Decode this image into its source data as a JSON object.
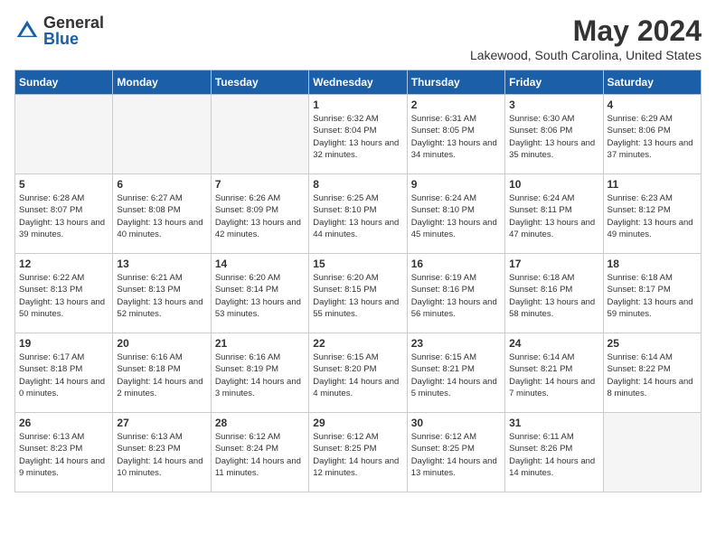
{
  "header": {
    "logo_general": "General",
    "logo_blue": "Blue",
    "month_year": "May 2024",
    "location": "Lakewood, South Carolina, United States"
  },
  "weekdays": [
    "Sunday",
    "Monday",
    "Tuesday",
    "Wednesday",
    "Thursday",
    "Friday",
    "Saturday"
  ],
  "weeks": [
    [
      {
        "day": "",
        "empty": true
      },
      {
        "day": "",
        "empty": true
      },
      {
        "day": "",
        "empty": true
      },
      {
        "day": "1",
        "sunrise": "6:32 AM",
        "sunset": "8:04 PM",
        "daylight": "13 hours and 32 minutes."
      },
      {
        "day": "2",
        "sunrise": "6:31 AM",
        "sunset": "8:05 PM",
        "daylight": "13 hours and 34 minutes."
      },
      {
        "day": "3",
        "sunrise": "6:30 AM",
        "sunset": "8:06 PM",
        "daylight": "13 hours and 35 minutes."
      },
      {
        "day": "4",
        "sunrise": "6:29 AM",
        "sunset": "8:06 PM",
        "daylight": "13 hours and 37 minutes."
      }
    ],
    [
      {
        "day": "5",
        "sunrise": "6:28 AM",
        "sunset": "8:07 PM",
        "daylight": "13 hours and 39 minutes."
      },
      {
        "day": "6",
        "sunrise": "6:27 AM",
        "sunset": "8:08 PM",
        "daylight": "13 hours and 40 minutes."
      },
      {
        "day": "7",
        "sunrise": "6:26 AM",
        "sunset": "8:09 PM",
        "daylight": "13 hours and 42 minutes."
      },
      {
        "day": "8",
        "sunrise": "6:25 AM",
        "sunset": "8:10 PM",
        "daylight": "13 hours and 44 minutes."
      },
      {
        "day": "9",
        "sunrise": "6:24 AM",
        "sunset": "8:10 PM",
        "daylight": "13 hours and 45 minutes."
      },
      {
        "day": "10",
        "sunrise": "6:24 AM",
        "sunset": "8:11 PM",
        "daylight": "13 hours and 47 minutes."
      },
      {
        "day": "11",
        "sunrise": "6:23 AM",
        "sunset": "8:12 PM",
        "daylight": "13 hours and 49 minutes."
      }
    ],
    [
      {
        "day": "12",
        "sunrise": "6:22 AM",
        "sunset": "8:13 PM",
        "daylight": "13 hours and 50 minutes."
      },
      {
        "day": "13",
        "sunrise": "6:21 AM",
        "sunset": "8:13 PM",
        "daylight": "13 hours and 52 minutes."
      },
      {
        "day": "14",
        "sunrise": "6:20 AM",
        "sunset": "8:14 PM",
        "daylight": "13 hours and 53 minutes."
      },
      {
        "day": "15",
        "sunrise": "6:20 AM",
        "sunset": "8:15 PM",
        "daylight": "13 hours and 55 minutes."
      },
      {
        "day": "16",
        "sunrise": "6:19 AM",
        "sunset": "8:16 PM",
        "daylight": "13 hours and 56 minutes."
      },
      {
        "day": "17",
        "sunrise": "6:18 AM",
        "sunset": "8:16 PM",
        "daylight": "13 hours and 58 minutes."
      },
      {
        "day": "18",
        "sunrise": "6:18 AM",
        "sunset": "8:17 PM",
        "daylight": "13 hours and 59 minutes."
      }
    ],
    [
      {
        "day": "19",
        "sunrise": "6:17 AM",
        "sunset": "8:18 PM",
        "daylight": "14 hours and 0 minutes."
      },
      {
        "day": "20",
        "sunrise": "6:16 AM",
        "sunset": "8:18 PM",
        "daylight": "14 hours and 2 minutes."
      },
      {
        "day": "21",
        "sunrise": "6:16 AM",
        "sunset": "8:19 PM",
        "daylight": "14 hours and 3 minutes."
      },
      {
        "day": "22",
        "sunrise": "6:15 AM",
        "sunset": "8:20 PM",
        "daylight": "14 hours and 4 minutes."
      },
      {
        "day": "23",
        "sunrise": "6:15 AM",
        "sunset": "8:21 PM",
        "daylight": "14 hours and 5 minutes."
      },
      {
        "day": "24",
        "sunrise": "6:14 AM",
        "sunset": "8:21 PM",
        "daylight": "14 hours and 7 minutes."
      },
      {
        "day": "25",
        "sunrise": "6:14 AM",
        "sunset": "8:22 PM",
        "daylight": "14 hours and 8 minutes."
      }
    ],
    [
      {
        "day": "26",
        "sunrise": "6:13 AM",
        "sunset": "8:23 PM",
        "daylight": "14 hours and 9 minutes."
      },
      {
        "day": "27",
        "sunrise": "6:13 AM",
        "sunset": "8:23 PM",
        "daylight": "14 hours and 10 minutes."
      },
      {
        "day": "28",
        "sunrise": "6:12 AM",
        "sunset": "8:24 PM",
        "daylight": "14 hours and 11 minutes."
      },
      {
        "day": "29",
        "sunrise": "6:12 AM",
        "sunset": "8:25 PM",
        "daylight": "14 hours and 12 minutes."
      },
      {
        "day": "30",
        "sunrise": "6:12 AM",
        "sunset": "8:25 PM",
        "daylight": "14 hours and 13 minutes."
      },
      {
        "day": "31",
        "sunrise": "6:11 AM",
        "sunset": "8:26 PM",
        "daylight": "14 hours and 14 minutes."
      },
      {
        "day": "",
        "empty": true
      }
    ]
  ]
}
